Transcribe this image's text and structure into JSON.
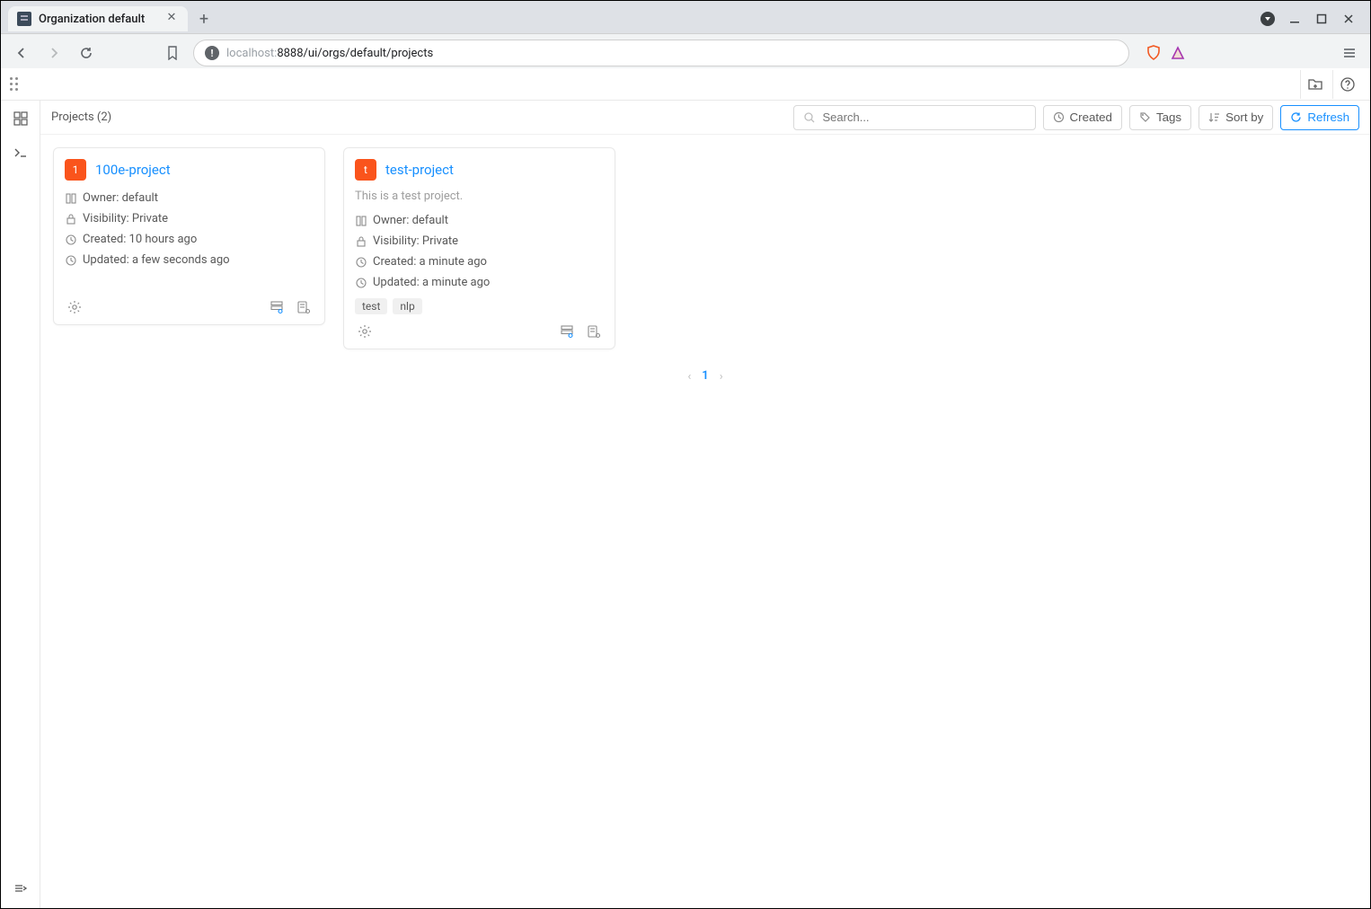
{
  "browser": {
    "tab_title": "Organization default",
    "url_host": "localhost:",
    "url_port_path": "8888/ui/orgs/default/projects"
  },
  "topbar": {},
  "toolbar": {
    "title": "Projects (2)",
    "search_placeholder": "Search...",
    "created_label": "Created",
    "tags_label": "Tags",
    "sortby_label": "Sort by",
    "refresh_label": "Refresh"
  },
  "projects": [
    {
      "avatar": "1",
      "name": "100e-project",
      "description": "",
      "owner": "Owner: default",
      "visibility": "Visibility: Private",
      "created": "Created: 10 hours ago",
      "updated": "Updated: a few seconds ago",
      "tags": []
    },
    {
      "avatar": "t",
      "name": "test-project",
      "description": "This is a test project.",
      "owner": "Owner: default",
      "visibility": "Visibility: Private",
      "created": "Created: a minute ago",
      "updated": "Updated: a minute ago",
      "tags": [
        "test",
        "nlp"
      ]
    }
  ],
  "pagination": {
    "current": "1"
  }
}
